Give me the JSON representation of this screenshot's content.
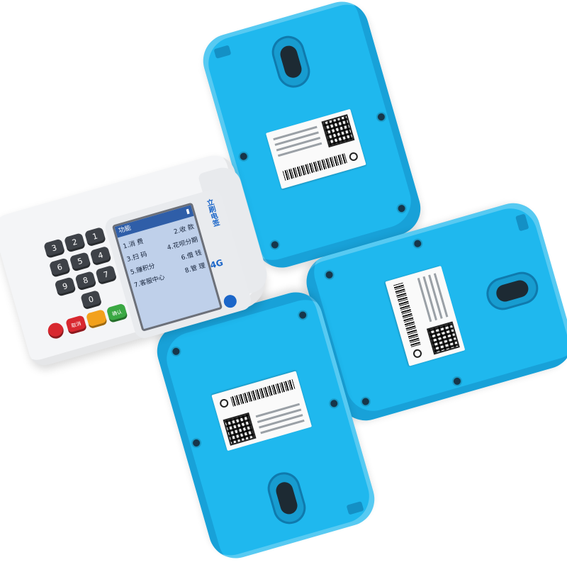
{
  "colors": {
    "back_blue": "#1fb8ee",
    "terminal_white": "#f4f5f7",
    "screen_blue": "#bfd0ea"
  },
  "backs": [
    {
      "id": "top",
      "rotation_deg": -16,
      "color": "#1fb8ee"
    },
    {
      "id": "right",
      "rotation_deg": 74,
      "color": "#1fb8ee"
    },
    {
      "id": "bottom",
      "rotation_deg": 164,
      "color": "#1fb8ee"
    }
  ],
  "terminal": {
    "brand": "立刷电签",
    "network_badge": "4G",
    "screen": {
      "title": "功能",
      "menu": [
        {
          "left": "1.消 费",
          "right": "2.收 款"
        },
        {
          "left": "3.扫 码",
          "right": "4.花呗分期"
        },
        {
          "left": "5.赚积分",
          "right": "6.借 钱"
        },
        {
          "left": "7.客服中心",
          "right": "8.管 理"
        }
      ]
    },
    "keys": {
      "k1": "1",
      "k2": "2",
      "k3": "3",
      "k4": "4",
      "k5": "5",
      "k6": "6",
      "k7": "7",
      "k8": "8",
      "k9": "9",
      "k0": "0",
      "confirm": "确认",
      "cancel": "取消"
    }
  }
}
